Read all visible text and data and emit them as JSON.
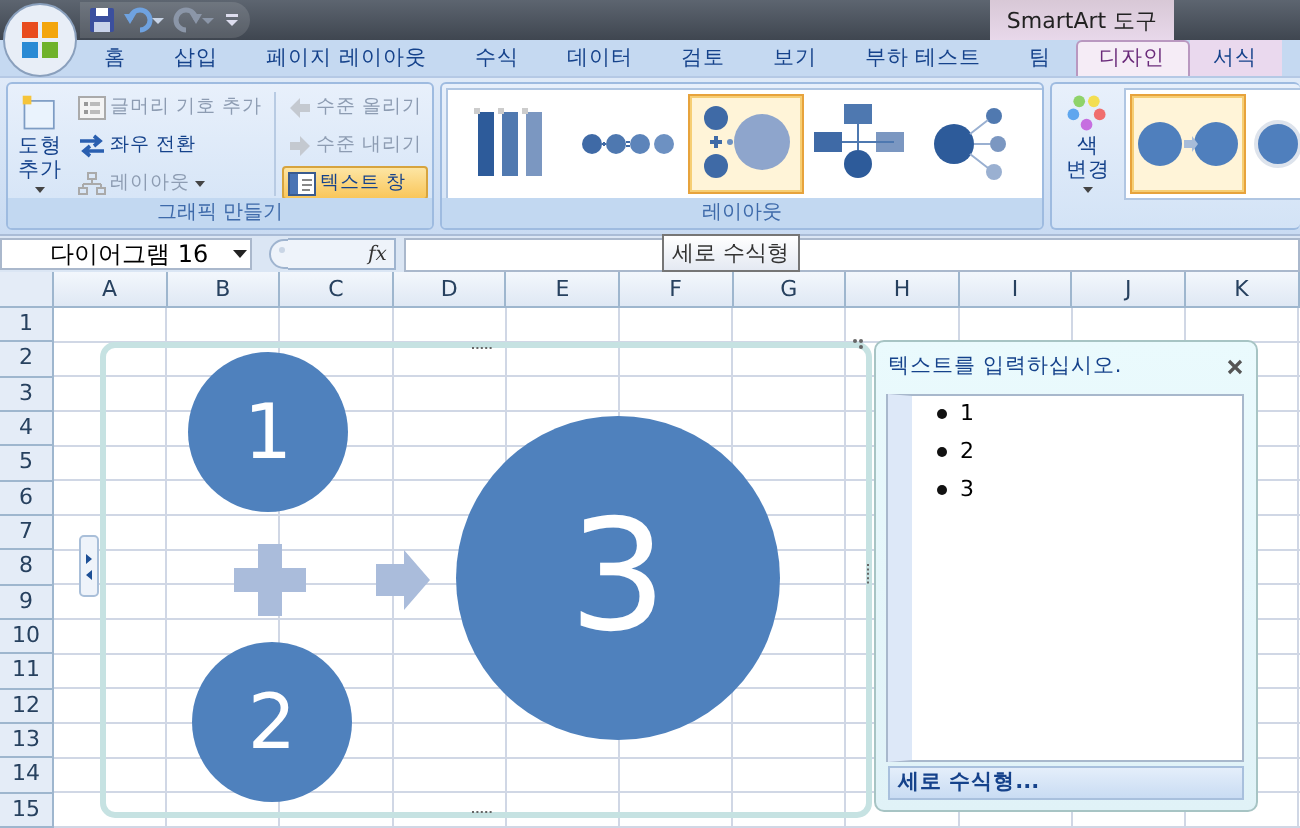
{
  "title_bar": {
    "contextual_title": "SmartArt 도구"
  },
  "tabs": [
    {
      "label": "홈",
      "selected": false,
      "contextual": false
    },
    {
      "label": "삽입",
      "selected": false,
      "contextual": false
    },
    {
      "label": "페이지 레이아웃",
      "selected": false,
      "contextual": false
    },
    {
      "label": "수식",
      "selected": false,
      "contextual": false
    },
    {
      "label": "데이터",
      "selected": false,
      "contextual": false
    },
    {
      "label": "검토",
      "selected": false,
      "contextual": false
    },
    {
      "label": "보기",
      "selected": false,
      "contextual": false
    },
    {
      "label": "부하 테스트",
      "selected": false,
      "contextual": false
    },
    {
      "label": "팀",
      "selected": false,
      "contextual": false
    },
    {
      "label": "디자인",
      "selected": true,
      "contextual": true
    },
    {
      "label": "서식",
      "selected": false,
      "contextual": true
    }
  ],
  "ribbon": {
    "groups": [
      {
        "label": "그래픽 만들기",
        "controls": [
          {
            "kind": "shape",
            "label": "도형 추가",
            "disabled": false,
            "dropdown": true,
            "selected": false
          },
          {
            "kind": "bullet",
            "label": "글머리 기호 추가",
            "disabled": true,
            "dropdown": false,
            "selected": false
          },
          {
            "kind": "swap",
            "label": "좌우 전환",
            "disabled": false,
            "dropdown": false,
            "selected": false
          },
          {
            "kind": "layout",
            "label": "레이아웃",
            "disabled": true,
            "dropdown": true,
            "selected": false
          },
          {
            "kind": "promote",
            "label": "수준 올리기",
            "disabled": true,
            "dropdown": false,
            "selected": false
          },
          {
            "kind": "demote",
            "label": "수준 내리기",
            "disabled": true,
            "dropdown": false,
            "selected": false
          },
          {
            "kind": "textpane",
            "label": "텍스트 창",
            "disabled": false,
            "dropdown": false,
            "selected": true
          }
        ]
      },
      {
        "label": "레이아웃",
        "gallery": [
          {
            "kind": "bars",
            "selected": false
          },
          {
            "kind": "equation",
            "selected": false
          },
          {
            "kind": "vertical-equation",
            "selected": true
          },
          {
            "kind": "hierarchy",
            "selected": false
          },
          {
            "kind": "radial",
            "selected": false
          }
        ]
      },
      {
        "controls": [
          {
            "kind": "color",
            "label": "색 변경",
            "disabled": false,
            "dropdown": true,
            "selected": false
          }
        ],
        "gallery": [
          {
            "kind": "style-flat",
            "selected": true
          },
          {
            "kind": "style-ring",
            "selected": false
          }
        ]
      }
    ]
  },
  "formula_bar": {
    "name_box": "다이어그램 16",
    "function_button": "fx",
    "tooltip": "세로 수식형"
  },
  "sheet": {
    "columns": [
      "A",
      "B",
      "C",
      "D",
      "E",
      "F",
      "G",
      "H",
      "I",
      "J",
      "K"
    ],
    "rows": [
      "1",
      "2",
      "3",
      "4",
      "5",
      "6",
      "7",
      "8",
      "9",
      "10",
      "11",
      "12",
      "13",
      "14",
      "15"
    ]
  },
  "diagram": {
    "shapes": [
      {
        "kind": "circle",
        "label": "1"
      },
      {
        "kind": "plus"
      },
      {
        "kind": "arrow"
      },
      {
        "kind": "circle",
        "label": "2"
      },
      {
        "kind": "circle",
        "label": "3"
      }
    ]
  },
  "text_pane": {
    "title": "텍스트를 입력하십시오.",
    "items": [
      "1",
      "2",
      "3"
    ],
    "footer": "세로 수식형..."
  }
}
